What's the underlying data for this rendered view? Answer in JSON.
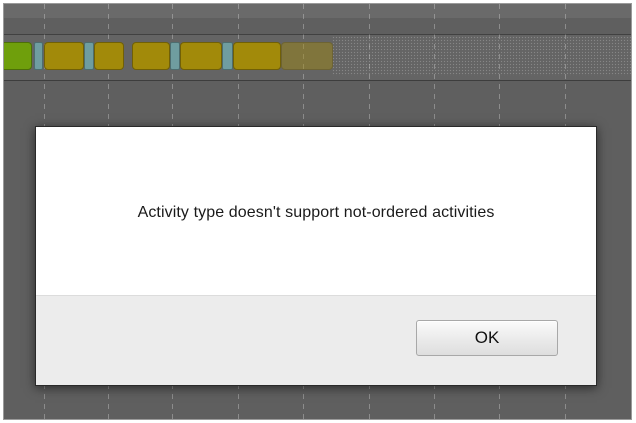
{
  "dialog": {
    "message": "Activity type doesn't support not-ordered activities",
    "ok_label": "OK"
  },
  "background": {
    "activity_colors": {
      "green": "#6f9f0c",
      "gold": "#a28a0a",
      "teal": "#6f9da0"
    }
  }
}
